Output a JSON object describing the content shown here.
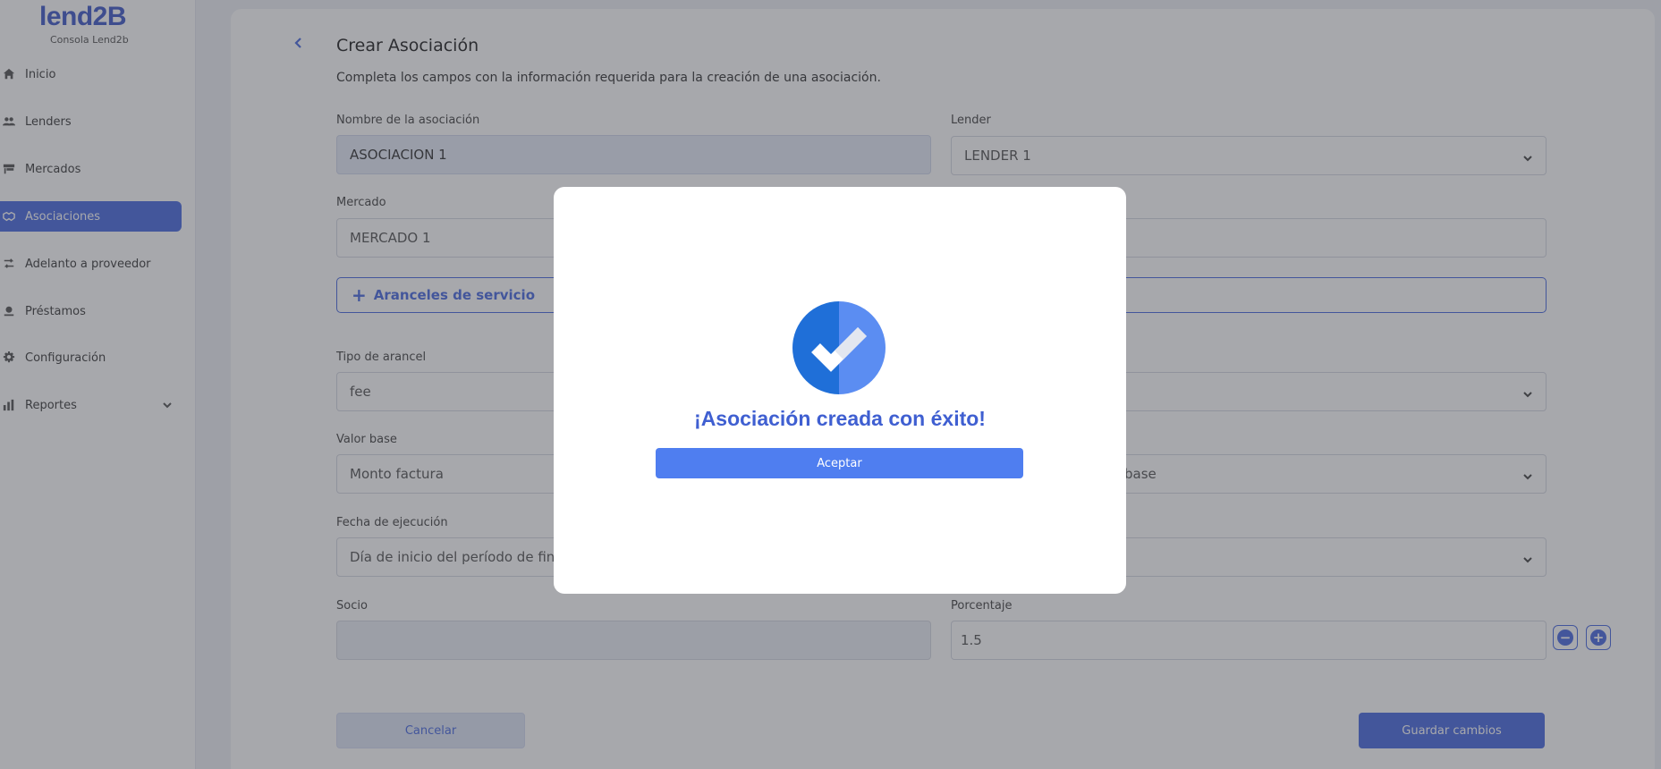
{
  "app": {
    "logo_text": "lend2B",
    "subtitle": "Consola Lend2b"
  },
  "sidebar": {
    "items": [
      {
        "label": "Inicio",
        "icon": "home-icon"
      },
      {
        "label": "Lenders",
        "icon": "users-icon"
      },
      {
        "label": "Mercados",
        "icon": "store-icon"
      },
      {
        "label": "Asociaciones",
        "icon": "handshake-icon",
        "active": true
      },
      {
        "label": "Adelanto a proveedor",
        "icon": "transfer-icon"
      },
      {
        "label": "Préstamos",
        "icon": "loan-icon"
      },
      {
        "label": "Configuración",
        "icon": "gear-icon"
      },
      {
        "label": "Reportes",
        "icon": "chart-icon",
        "expandable": true
      }
    ]
  },
  "form": {
    "title": "Crear Asociación",
    "description": "Completa los campos con la información requerida para la creación de una asociación.",
    "association_name": {
      "label": "Nombre de la asociación",
      "value": "ASOCIACION 1"
    },
    "lender": {
      "label": "Lender",
      "value": "LENDER 1"
    },
    "market": {
      "label": "Mercado",
      "value": "MERCADO 1"
    },
    "fees_button": "Aranceles de servicio",
    "fee_type": {
      "label": "Tipo de arancel",
      "value": "fee"
    },
    "base_value": {
      "label": "Valor base",
      "value": "Monto factura"
    },
    "base_right": {
      "value": "base"
    },
    "execution_date": {
      "label": "Fecha de ejecución",
      "value": "Día de inicio del período de finar"
    },
    "partner": {
      "label": "Socio",
      "value": ""
    },
    "percentage": {
      "label": "Porcentaje",
      "value": "1.5"
    },
    "cancel_label": "Cancelar",
    "save_label": "Guardar cambios"
  },
  "modal": {
    "title": "¡Asociación creada con éxito!",
    "accept_label": "Aceptar"
  },
  "colors": {
    "primary": "#4a6ae0",
    "modal_title": "#3f5fd1",
    "accept_button": "#4f7ef0",
    "success_dark": "#1f6fd8",
    "success_light": "#5b8df2"
  }
}
